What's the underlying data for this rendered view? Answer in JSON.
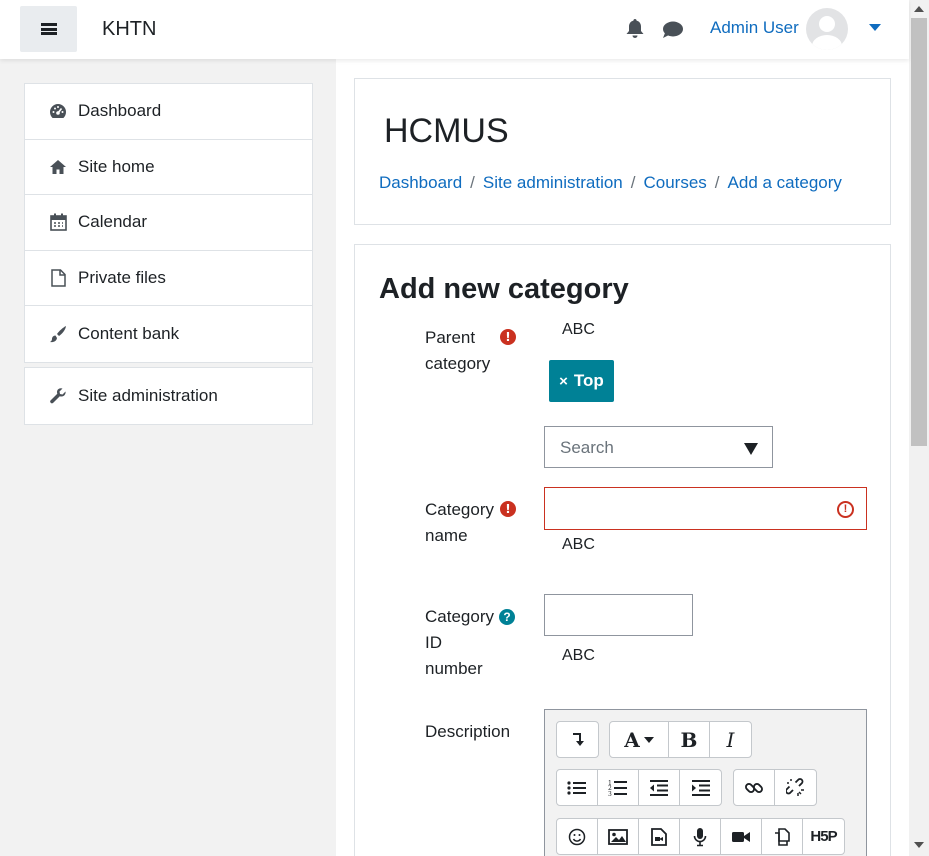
{
  "navbar": {
    "site_name": "KHTN",
    "user_name": "Admin User"
  },
  "drawer": {
    "items": [
      {
        "label": "Dashboard",
        "icon": "dashboard-icon"
      },
      {
        "label": "Site home",
        "icon": "home-icon"
      },
      {
        "label": "Calendar",
        "icon": "calendar-icon"
      },
      {
        "label": "Private files",
        "icon": "file-icon"
      },
      {
        "label": "Content bank",
        "icon": "paintbrush-icon"
      }
    ],
    "admin_item": {
      "label": "Site administration",
      "icon": "wrench-icon"
    }
  },
  "header": {
    "title": "HCMUS",
    "breadcrumb": [
      "Dashboard",
      "Site administration",
      "Courses",
      "Add a category"
    ],
    "separator": "/"
  },
  "form": {
    "title": "Add new category",
    "parent_category": {
      "label": "Parent category",
      "below": "ABC",
      "selected_tag": "Top",
      "remove_glyph": "×",
      "search_placeholder": "Search"
    },
    "category_name": {
      "label": "Category name",
      "value": "",
      "below": "ABC"
    },
    "category_id": {
      "label": "Category ID number",
      "value": "",
      "below": "ABC"
    },
    "description": {
      "label": "Description"
    }
  },
  "colors": {
    "link": "#0f6cbf",
    "required": "#ca3120",
    "tag": "#008196"
  }
}
